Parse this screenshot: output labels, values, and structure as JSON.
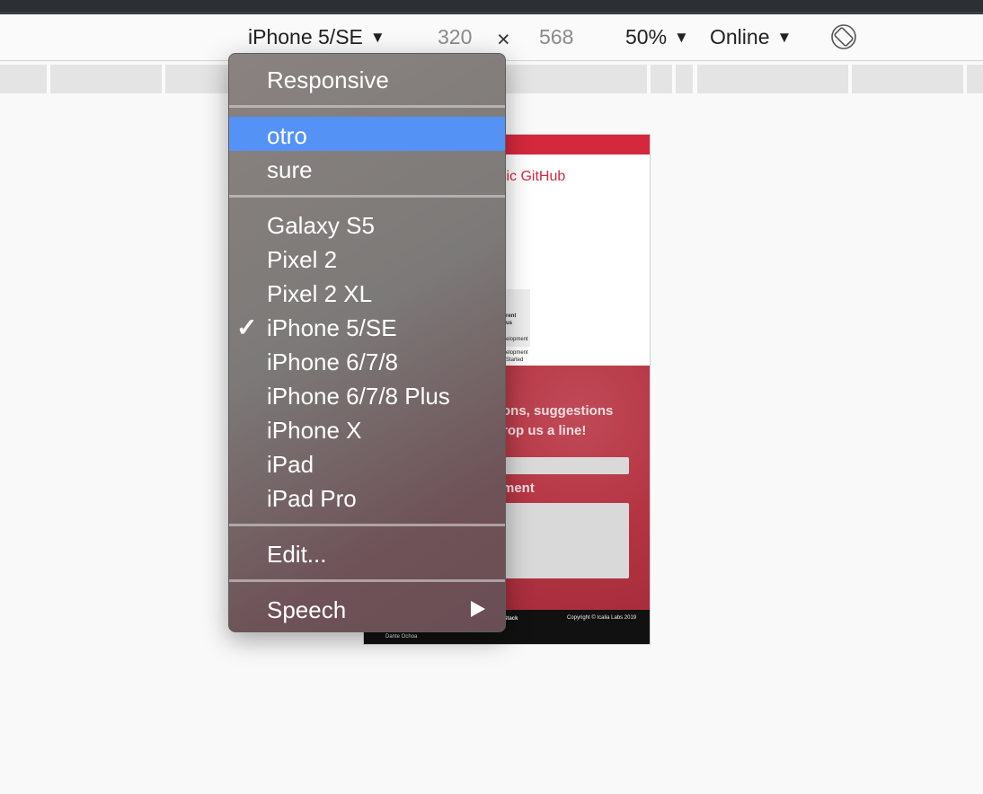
{
  "toolbar": {
    "device": "iPhone 5/SE",
    "width": "320",
    "times": "×",
    "height": "568",
    "zoom": "50%",
    "network": "Online",
    "caret": "▼"
  },
  "page_preview": {
    "link_text": "blic GitHub",
    "card_title_1": "rent",
    "card_title_2": "us",
    "card_line_1": "elopment",
    "card_line_2": "elopment",
    "card_line_3": "Started",
    "hero_line_1": "ons, suggestions",
    "hero_line_2": "rop us a line!",
    "comment_label": "ment",
    "footer_stack": "g Stack",
    "footer_copyright": "Copyright © Icalia Labs 2019",
    "footer_author": "Dante Ochoa"
  },
  "menu": {
    "items": [
      {
        "label": "Responsive"
      },
      {
        "label": "otro"
      },
      {
        "label": "sure"
      },
      {
        "label": "Galaxy S5"
      },
      {
        "label": "Pixel 2"
      },
      {
        "label": "Pixel 2 XL"
      },
      {
        "label": "iPhone 5/SE"
      },
      {
        "label": "iPhone 6/7/8"
      },
      {
        "label": "iPhone 6/7/8 Plus"
      },
      {
        "label": "iPhone X"
      },
      {
        "label": "iPad"
      },
      {
        "label": "iPad Pro"
      },
      {
        "label": "Edit..."
      },
      {
        "label": "Speech"
      }
    ],
    "checkmark": "✓",
    "highlighted": "otro",
    "checked": "iPhone 5/SE"
  }
}
